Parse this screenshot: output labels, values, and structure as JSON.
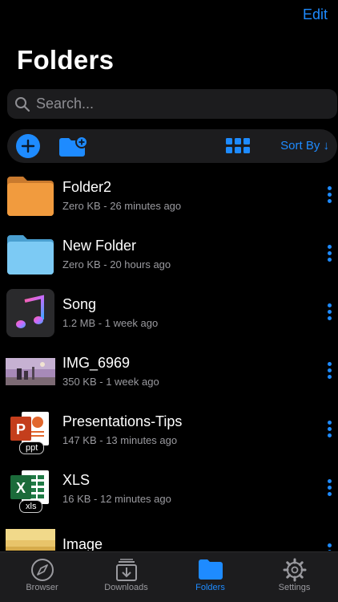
{
  "header": {
    "edit_label": "Edit",
    "title": "Folders"
  },
  "search": {
    "placeholder": "Search..."
  },
  "toolbar": {
    "sort_label": "Sort By ↓"
  },
  "files": [
    {
      "name": "Folder2",
      "meta": "Zero KB - 26 minutes ago",
      "kind": "folder-orange"
    },
    {
      "name": "New Folder",
      "meta": "Zero KB - 20 hours ago",
      "kind": "folder-blue"
    },
    {
      "name": "Song",
      "meta": "1.2 MB - 1 week ago",
      "kind": "music"
    },
    {
      "name": "IMG_6969",
      "meta": "350 KB - 1 week ago",
      "kind": "photo"
    },
    {
      "name": "Presentations-Tips",
      "meta": "147 KB - 13 minutes ago",
      "kind": "ppt",
      "badge": "ppt"
    },
    {
      "name": "XLS",
      "meta": "16 KB - 12 minutes ago",
      "kind": "xls",
      "badge": "xls"
    },
    {
      "name": "Image",
      "meta": "",
      "kind": "image"
    }
  ],
  "tabs": [
    {
      "label": "Browser",
      "icon": "compass-icon"
    },
    {
      "label": "Downloads",
      "icon": "download-tray-icon"
    },
    {
      "label": "Folders",
      "icon": "folder-icon",
      "active": true
    },
    {
      "label": "Settings",
      "icon": "gear-icon"
    }
  ],
  "colors": {
    "accent": "#1e8bff",
    "background": "#000000",
    "surface": "#1c1c1e"
  }
}
